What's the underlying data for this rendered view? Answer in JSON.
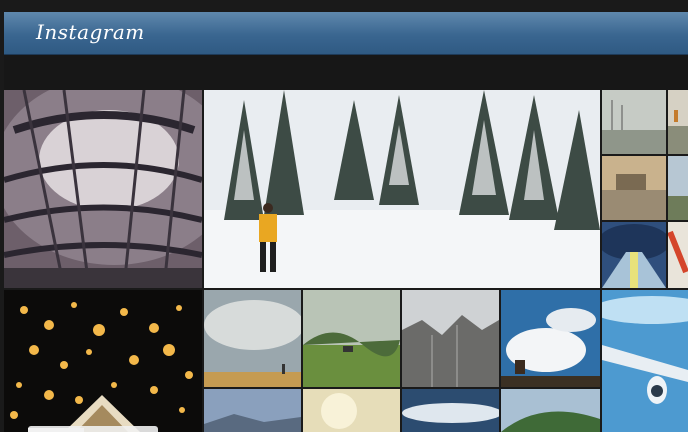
{
  "app": {
    "brand": "Instagram"
  },
  "photos": [
    {
      "id": "p1",
      "subject": "glass-dome-architecture"
    },
    {
      "id": "p2",
      "subject": "snowy-forest-walker"
    },
    {
      "id": "p3",
      "subject": "foggy-field"
    },
    {
      "id": "p4",
      "subject": "cliff-stairs"
    },
    {
      "id": "p5",
      "subject": "pond-reflection"
    },
    {
      "id": "p6",
      "subject": "cyclist"
    },
    {
      "id": "p7",
      "subject": "train-station"
    },
    {
      "id": "p8",
      "subject": "red-sculpture"
    },
    {
      "id": "p9",
      "subject": "sky-lanterns"
    },
    {
      "id": "p10",
      "subject": "cloudy-field-person"
    },
    {
      "id": "p11",
      "subject": "green-hills"
    },
    {
      "id": "p12",
      "subject": "rocky-mountains"
    },
    {
      "id": "p13",
      "subject": "deer-on-hill"
    },
    {
      "id": "p14",
      "subject": "airplane-wing"
    },
    {
      "id": "p15",
      "subject": "dusk-mountains"
    },
    {
      "id": "p16",
      "subject": "hazy-sun"
    },
    {
      "id": "p17",
      "subject": "sea-of-clouds"
    },
    {
      "id": "p18",
      "subject": "hill-greenery"
    }
  ]
}
